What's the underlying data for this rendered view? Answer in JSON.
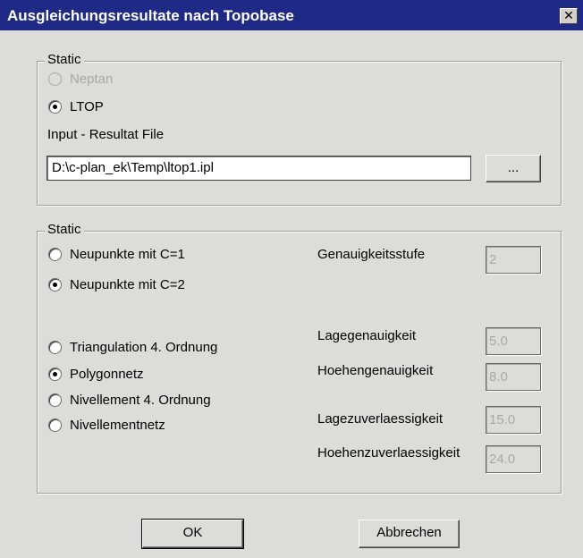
{
  "window": {
    "title": "Ausgleichungsresultate nach Topobase",
    "close_icon": "close-icon",
    "close_glyph": "✕"
  },
  "group1": {
    "legend": "Static",
    "radio_neptan": {
      "label": "Neptan",
      "checked": false,
      "disabled": true
    },
    "radio_ltop": {
      "label": "LTOP",
      "checked": true
    },
    "file_label": "Input - Resultat File",
    "file_value": "D:\\c-plan_ek\\Temp\\ltop1.ipl",
    "browse_label": "..."
  },
  "group2": {
    "legend": "Static",
    "points_options": [
      {
        "label": "Neupunkte mit C=1",
        "checked": false
      },
      {
        "label": "Neupunkte mit C=2",
        "checked": true
      }
    ],
    "network_options": [
      {
        "label": "Triangulation 4. Ordnung",
        "checked": false
      },
      {
        "label": "Polygonnetz",
        "checked": true
      },
      {
        "label": "Nivellement 4. Ordnung",
        "checked": false
      },
      {
        "label": "Nivellementnetz",
        "checked": false
      }
    ],
    "fields": [
      {
        "label": "Genauigkeitsstufe",
        "value": "2"
      },
      {
        "label": "Lagegenauigkeit",
        "value": "5.0"
      },
      {
        "label": "Hoehengenauigkeit",
        "value": "8.0"
      },
      {
        "label": "Lagezuverlaessigkeit",
        "value": "15.0"
      },
      {
        "label": "Hoehenzuverlaessigkeit",
        "value": "24.0"
      }
    ]
  },
  "buttons": {
    "ok": "OK",
    "cancel": "Abbrechen"
  },
  "colors": {
    "titlebar": "#1f2a86",
    "dialog_bg": "#dcdcd8"
  }
}
